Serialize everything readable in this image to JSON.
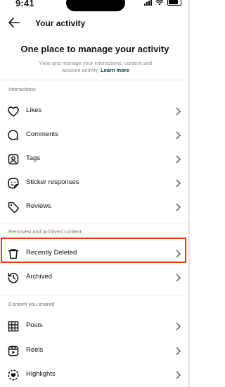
{
  "status": {
    "time": "9:41"
  },
  "header": {
    "title": "Your activity"
  },
  "hero": {
    "title": "One place to manage your activity",
    "subtitle": "View and manage your interactions, content and account activity.",
    "link": "Learn more"
  },
  "sections": {
    "interactions": {
      "label": "Interactions",
      "items": [
        {
          "label": "Likes",
          "icon": "heart-icon"
        },
        {
          "label": "Comments",
          "icon": "comment-icon"
        },
        {
          "label": "Tags",
          "icon": "tag-person-icon"
        },
        {
          "label": "Sticker responses",
          "icon": "sticker-icon"
        },
        {
          "label": "Reviews",
          "icon": "review-tag-icon"
        }
      ]
    },
    "removed": {
      "label": "Removed and archived content",
      "items": [
        {
          "label": "Recently Deleted",
          "icon": "trash-icon"
        },
        {
          "label": "Archived",
          "icon": "archive-clock-icon"
        }
      ]
    },
    "shared": {
      "label": "Content you shared",
      "items": [
        {
          "label": "Posts",
          "icon": "grid-icon"
        },
        {
          "label": "Reels",
          "icon": "reels-icon"
        },
        {
          "label": "Highlights",
          "icon": "highlights-icon"
        }
      ]
    }
  },
  "colors": {
    "highlight": "#e8391d",
    "link": "#00376b",
    "muted": "#737373"
  }
}
